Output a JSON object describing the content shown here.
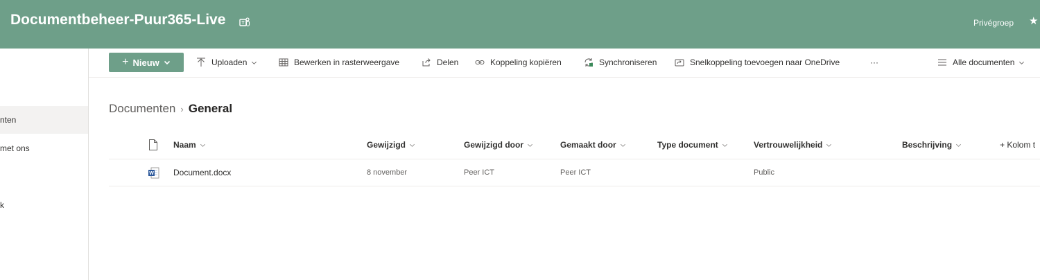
{
  "header": {
    "site_title": "Documentbeheer-Puur365-Live",
    "privacy": "Privégroep",
    "teams_icon": "teams-icon",
    "star_icon": "star-icon",
    "bg_color": "#6e9f89"
  },
  "leftnav": {
    "items": [
      {
        "label": "nten",
        "selected": true
      },
      {
        "label": "met ons",
        "selected": false
      },
      {
        "label": "k",
        "selected": false
      }
    ]
  },
  "commandbar": {
    "new_label": "Nieuw",
    "upload_label": "Uploaden",
    "grid_edit_label": "Bewerken in rasterweergave",
    "share_label": "Delen",
    "copy_link_label": "Koppeling kopiëren",
    "sync_label": "Synchroniseren",
    "shortcut_label": "Snelkoppeling toevoegen naar OneDrive",
    "more_label": "···",
    "view_label": "Alle documenten"
  },
  "breadcrumb": {
    "root": "Documenten",
    "separator": "›",
    "current": "General"
  },
  "columns": {
    "name": "Naam",
    "modified": "Gewijzigd",
    "modified_by": "Gewijzigd door",
    "created_by": "Gemaakt door",
    "doc_type": "Type document",
    "confidentiality": "Vertrouwelijkheid",
    "description": "Beschrijving",
    "add_column": "+ Kolom t"
  },
  "rows": [
    {
      "icon": "word-document-icon",
      "name": "Document.docx",
      "modified": "8 november",
      "modified_by": "Peer ICT",
      "created_by": "Peer ICT",
      "doc_type": "",
      "confidentiality": "Public",
      "description": ""
    }
  ]
}
